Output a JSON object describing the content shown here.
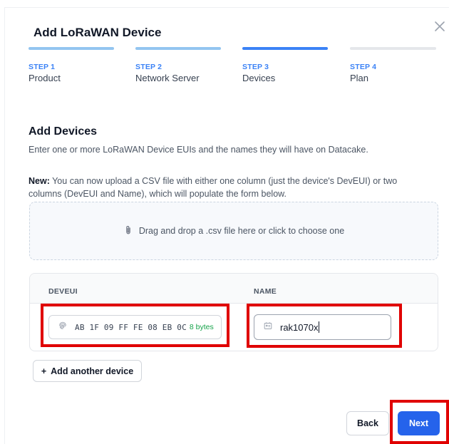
{
  "dialog": {
    "title": "Add LoRaWAN Device"
  },
  "steps": [
    {
      "number": "STEP 1",
      "label": "Product",
      "state": "done"
    },
    {
      "number": "STEP 2",
      "label": "Network Server",
      "state": "done"
    },
    {
      "number": "STEP 3",
      "label": "Devices",
      "state": "active"
    },
    {
      "number": "STEP 4",
      "label": "Plan",
      "state": "todo"
    }
  ],
  "section": {
    "title": "Add Devices",
    "description": "Enter one or more LoRaWAN Device EUIs and the names they will have on Datacake.",
    "note_prefix": "New:",
    "note_text": " You can now upload a CSV file with either one column (just the device's DevEUI) or two columns (DevEUI and Name), which will populate the form below."
  },
  "dropzone": {
    "text": "Drag and drop a .csv file here or click to choose one",
    "icon": "paperclip-icon"
  },
  "table": {
    "headers": [
      "DEVEUI",
      "NAME"
    ],
    "rows": [
      {
        "deveui": "AB 1F 09 FF FE 08 EB 0C",
        "bytes": "8 bytes",
        "name": "rak1070x"
      }
    ]
  },
  "buttons": {
    "add_another": "Add another device",
    "add_prefix": "+",
    "back": "Back",
    "next": "Next"
  },
  "colors": {
    "primary": "#2563eb",
    "step_done": "#93c5f0",
    "step_active": "#3b82f6",
    "highlight": "#e00000",
    "bytes_ok": "#16a34a"
  }
}
